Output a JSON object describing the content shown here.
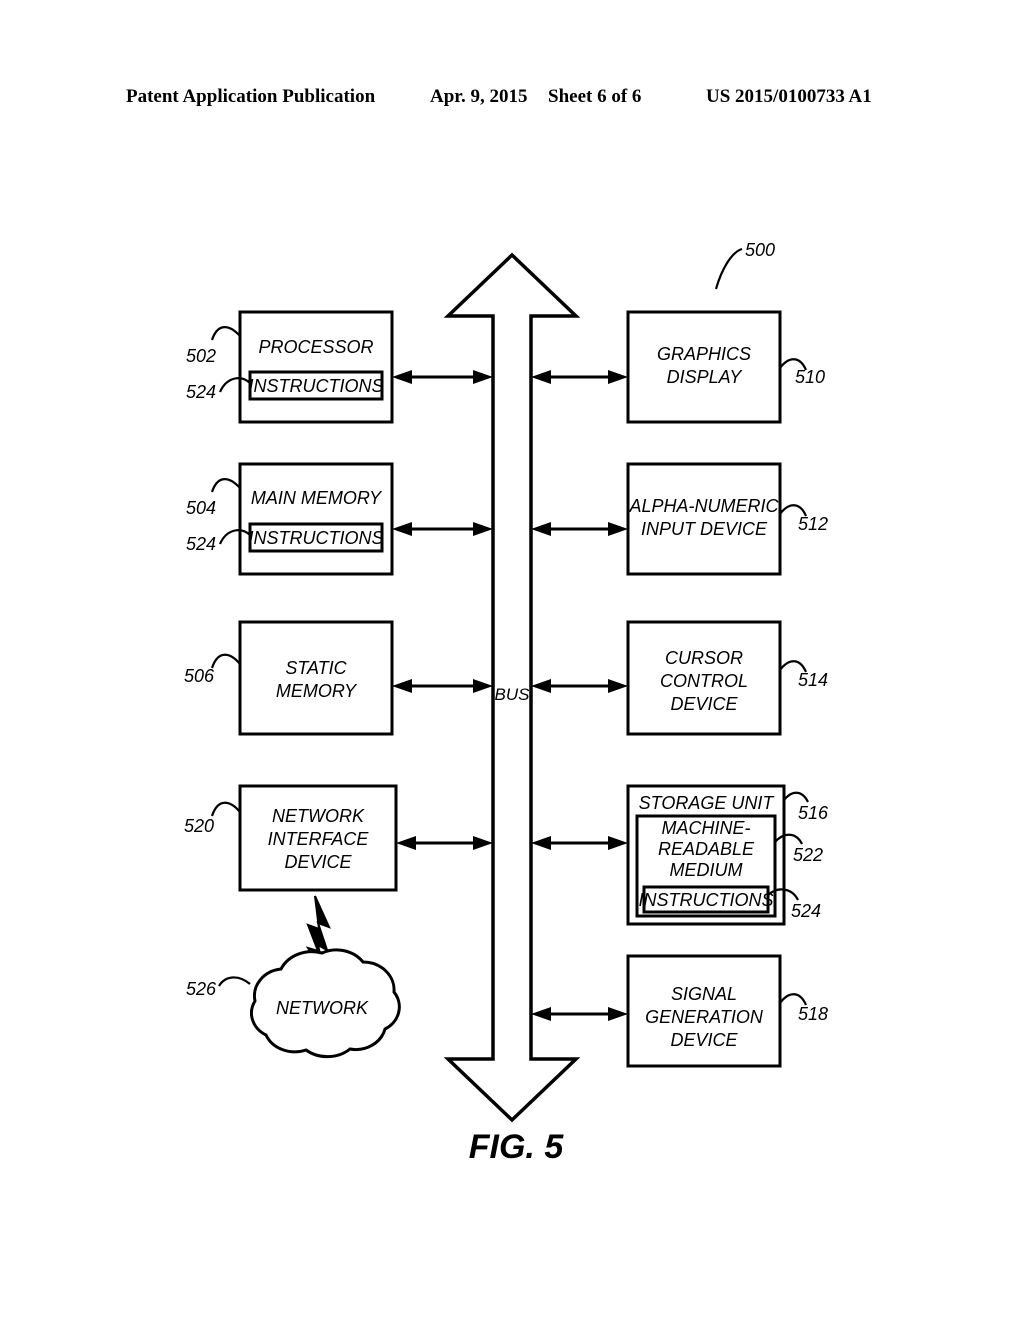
{
  "header": {
    "publication": "Patent Application Publication",
    "date": "Apr. 9, 2015",
    "sheet": "Sheet 6 of 6",
    "patent_number": "US 2015/0100733 A1"
  },
  "figure": {
    "caption": "FIG. 5",
    "system_ref": "500",
    "bus_label": "BUS",
    "blocks": [
      {
        "id": "processor",
        "label": "PROCESSOR",
        "ref": "502",
        "inner_label": "INSTRUCTIONS",
        "inner_ref": "524"
      },
      {
        "id": "main-memory",
        "label": "MAIN MEMORY",
        "ref": "504",
        "inner_label": "INSTRUCTIONS",
        "inner_ref": "524"
      },
      {
        "id": "static-memory",
        "label": "STATIC MEMORY",
        "ref": "506",
        "line1": "STATIC",
        "line2": "MEMORY"
      },
      {
        "id": "network-interface",
        "label": "NETWORK INTERFACE DEVICE",
        "ref": "520",
        "line1": "NETWORK",
        "line2": "INTERFACE",
        "line3": "DEVICE"
      },
      {
        "id": "graphics-display",
        "label": "GRAPHICS DISPLAY",
        "ref": "510",
        "line1": "GRAPHICS",
        "line2": "DISPLAY"
      },
      {
        "id": "alpha-numeric",
        "label": "ALPHA-NUMERIC INPUT DEVICE",
        "ref": "512",
        "line1": "ALPHA-NUMERIC",
        "line2": "INPUT DEVICE"
      },
      {
        "id": "cursor-control",
        "label": "CURSOR CONTROL DEVICE",
        "ref": "514",
        "line1": "CURSOR",
        "line2": "CONTROL",
        "line3": "DEVICE"
      },
      {
        "id": "storage-unit",
        "label": "STORAGE UNIT",
        "ref": "516"
      },
      {
        "id": "machine-medium",
        "label": "MACHINE-READABLE MEDIUM",
        "ref": "522",
        "line1": "MACHINE-",
        "line2": "READABLE",
        "line3": "MEDIUM"
      },
      {
        "id": "storage-instructions",
        "label": "INSTRUCTIONS",
        "ref": "524"
      },
      {
        "id": "signal-generation",
        "label": "SIGNAL GENERATION DEVICE",
        "ref": "518",
        "line1": "SIGNAL",
        "line2": "GENERATION",
        "line3": "DEVICE"
      },
      {
        "id": "network-cloud",
        "label": "NETWORK",
        "ref": "526"
      }
    ]
  }
}
